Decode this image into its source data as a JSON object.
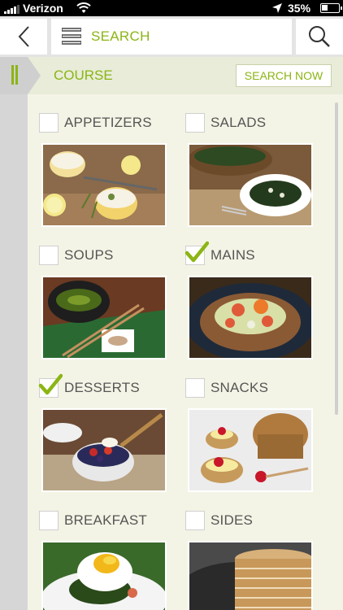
{
  "status_bar": {
    "carrier": "Verizon",
    "battery_percent": "35%",
    "battery_level": 0.35
  },
  "nav": {
    "search_label": "SEARCH",
    "icons": [
      "back-chevron-icon",
      "menu-icon",
      "magnifier-icon"
    ]
  },
  "course": {
    "title": "COURSE",
    "search_now_label": "SEARCH NOW"
  },
  "accent_color": "#8bb514",
  "courses": [
    {
      "label": "APPETIZERS",
      "checked": false
    },
    {
      "label": "SALADS",
      "checked": false
    },
    {
      "label": "SOUPS",
      "checked": false
    },
    {
      "label": "MAINS",
      "checked": true
    },
    {
      "label": "DESSERTS",
      "checked": true
    },
    {
      "label": "SNACKS",
      "checked": false
    },
    {
      "label": "BREAKFAST",
      "checked": false
    },
    {
      "label": "SIDES",
      "checked": false
    }
  ]
}
